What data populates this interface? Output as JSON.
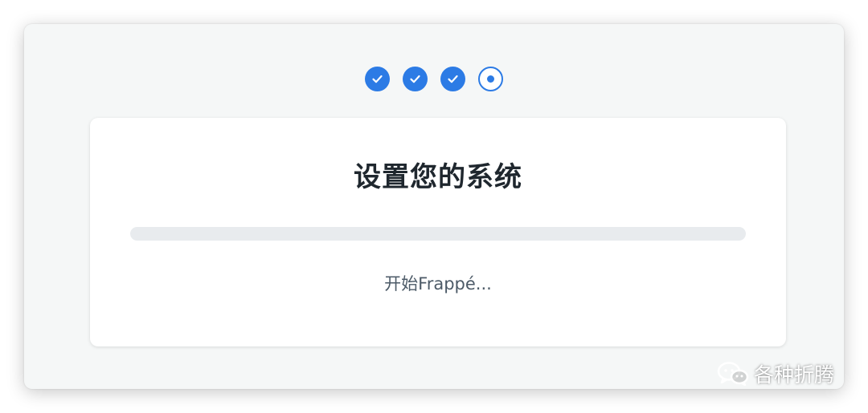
{
  "setup_wizard": {
    "steps": [
      {
        "state": "completed",
        "icon": "check-icon"
      },
      {
        "state": "completed",
        "icon": "check-icon"
      },
      {
        "state": "completed",
        "icon": "check-icon"
      },
      {
        "state": "current",
        "icon": "current-dot-icon"
      }
    ],
    "title": "设置您的系统",
    "progress": 0,
    "status": "开始Frappé..."
  },
  "watermark": {
    "icon": "wechat-icon",
    "text": "各种折腾"
  },
  "colors": {
    "accent": "#2c7be5",
    "background": "#f5f7f7",
    "card": "#ffffff",
    "track": "#e8ebee",
    "title": "#1f272e",
    "status": "#4c5a67"
  }
}
